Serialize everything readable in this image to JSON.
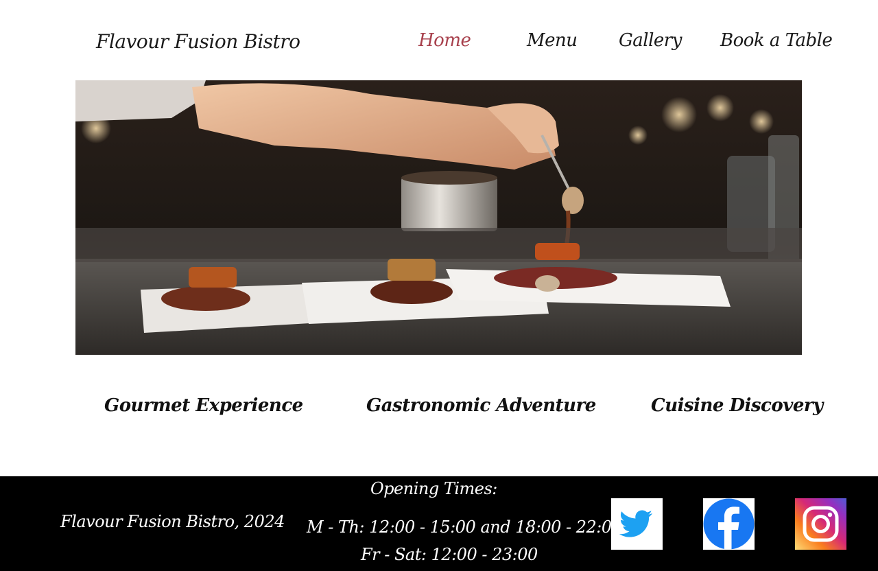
{
  "site": {
    "brand": "Flavour Fusion Bistro"
  },
  "nav": {
    "items": [
      {
        "label": "Home",
        "active": true
      },
      {
        "label": "Menu",
        "active": false
      },
      {
        "label": "Gallery",
        "active": false
      },
      {
        "label": "Book a Table",
        "active": false
      }
    ],
    "active_color": "#a8414d"
  },
  "hero": {
    "icon": "plated-food-image"
  },
  "features": [
    {
      "label": "Gourmet Experience"
    },
    {
      "label": "Gastronomic Adventure"
    },
    {
      "label": "Cuisine Discovery"
    }
  ],
  "footer": {
    "copyright": "Flavour Fusion Bistro, 2024",
    "hours_title": "Opening Times:",
    "hours": [
      "M - Th:  12:00 - 15:00 and 18:00 - 22:00",
      "Fr - Sat: 12:00 - 23:00"
    ],
    "social": [
      {
        "icon": "twitter-icon",
        "color": "#1da1f2"
      },
      {
        "icon": "facebook-icon",
        "color": "#1877f2"
      },
      {
        "icon": "instagram-icon",
        "color": "#e1306c"
      }
    ],
    "background": "#000000"
  }
}
